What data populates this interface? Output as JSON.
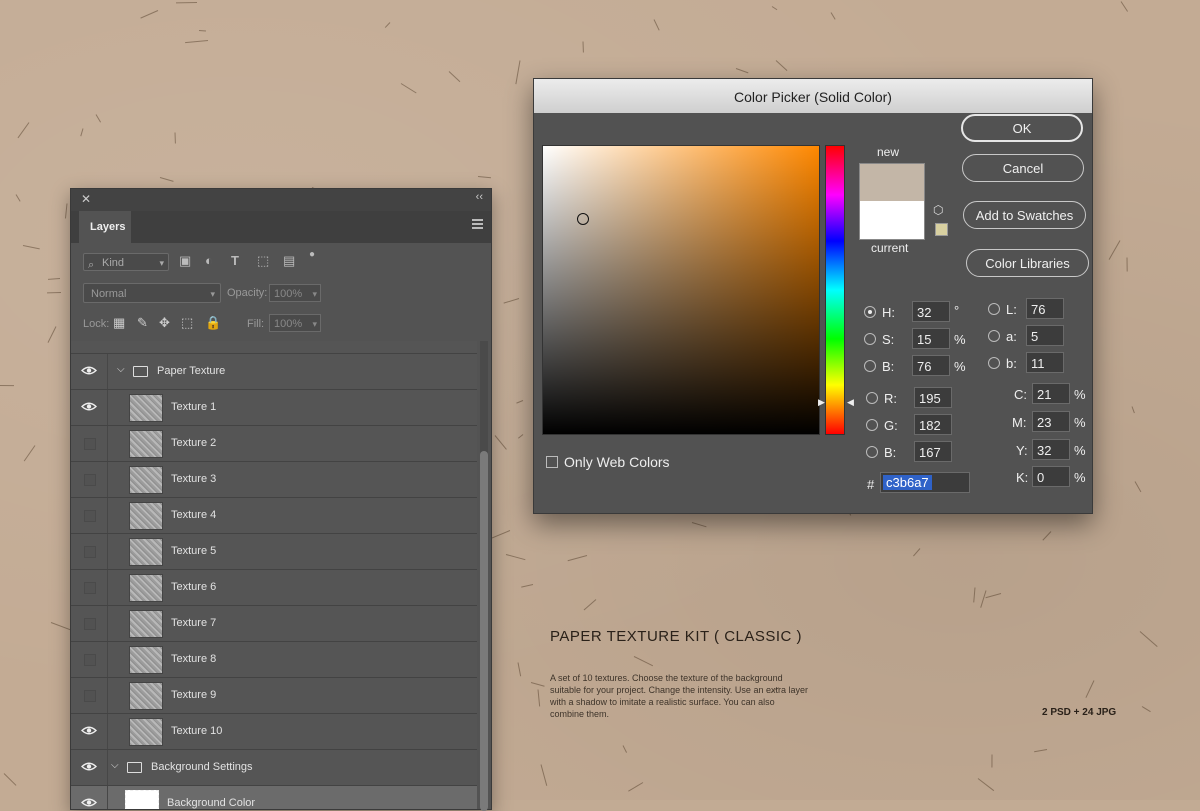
{
  "layers_panel": {
    "tab": "Layers",
    "filter_kind": "Kind",
    "blend_mode": "Normal",
    "opacity_label": "Opacity:",
    "opacity_value": "100%",
    "lock_label": "Lock:",
    "fill_label": "Fill:",
    "fill_value": "100%",
    "layers": [
      {
        "name": "Paper Texture",
        "type": "group",
        "visible": true
      },
      {
        "name": "Texture 1",
        "type": "layer",
        "visible": true
      },
      {
        "name": "Texture 2",
        "type": "layer",
        "visible": false
      },
      {
        "name": "Texture 3",
        "type": "layer",
        "visible": false
      },
      {
        "name": "Texture 4",
        "type": "layer",
        "visible": false
      },
      {
        "name": "Texture 5",
        "type": "layer",
        "visible": false
      },
      {
        "name": "Texture 6",
        "type": "layer",
        "visible": false
      },
      {
        "name": "Texture 7",
        "type": "layer",
        "visible": false
      },
      {
        "name": "Texture 8",
        "type": "layer",
        "visible": false
      },
      {
        "name": "Texture 9",
        "type": "layer",
        "visible": false
      },
      {
        "name": "Texture 10",
        "type": "layer",
        "visible": true
      },
      {
        "name": "Background Settings",
        "type": "group",
        "visible": true
      },
      {
        "name": "Background Color",
        "type": "fill",
        "visible": true
      }
    ]
  },
  "color_picker": {
    "title": "Color Picker (Solid Color)",
    "new_label": "new",
    "current_label": "current",
    "new_color": "#c3b6a7",
    "current_color": "#ffffff",
    "buttons": {
      "ok": "OK",
      "cancel": "Cancel",
      "add_swatches": "Add to Swatches",
      "libraries": "Color Libraries"
    },
    "only_web_colors": "Only Web Colors",
    "hsb": {
      "h_label": "H:",
      "h": "32",
      "h_unit": "°",
      "s_label": "S:",
      "s": "15",
      "s_unit": "%",
      "b_label": "B:",
      "b": "76",
      "b_unit": "%"
    },
    "rgb": {
      "r_label": "R:",
      "r": "195",
      "g_label": "G:",
      "g": "182",
      "b_label": "B:",
      "b": "167"
    },
    "lab": {
      "l_label": "L:",
      "l": "76",
      "a_label": "a:",
      "a": "5",
      "b_label": "b:",
      "b": "11"
    },
    "cmyk": {
      "c_label": "C:",
      "c": "21",
      "m_label": "M:",
      "m": "23",
      "y_label": "Y:",
      "y": "32",
      "k_label": "K:",
      "k": "0",
      "unit": "%"
    },
    "hex_label": "#",
    "hex": "c3b6a7"
  },
  "product": {
    "title": "PAPER TEXTURE KIT ( CLASSIC )",
    "description": "A set of 10 textures. Choose the texture of the background suitable for your project. Change the intensity. Use an extra layer with a shadow to imitate a realistic surface. You can also combine them.",
    "count": "2 PSD + 24 JPG"
  }
}
